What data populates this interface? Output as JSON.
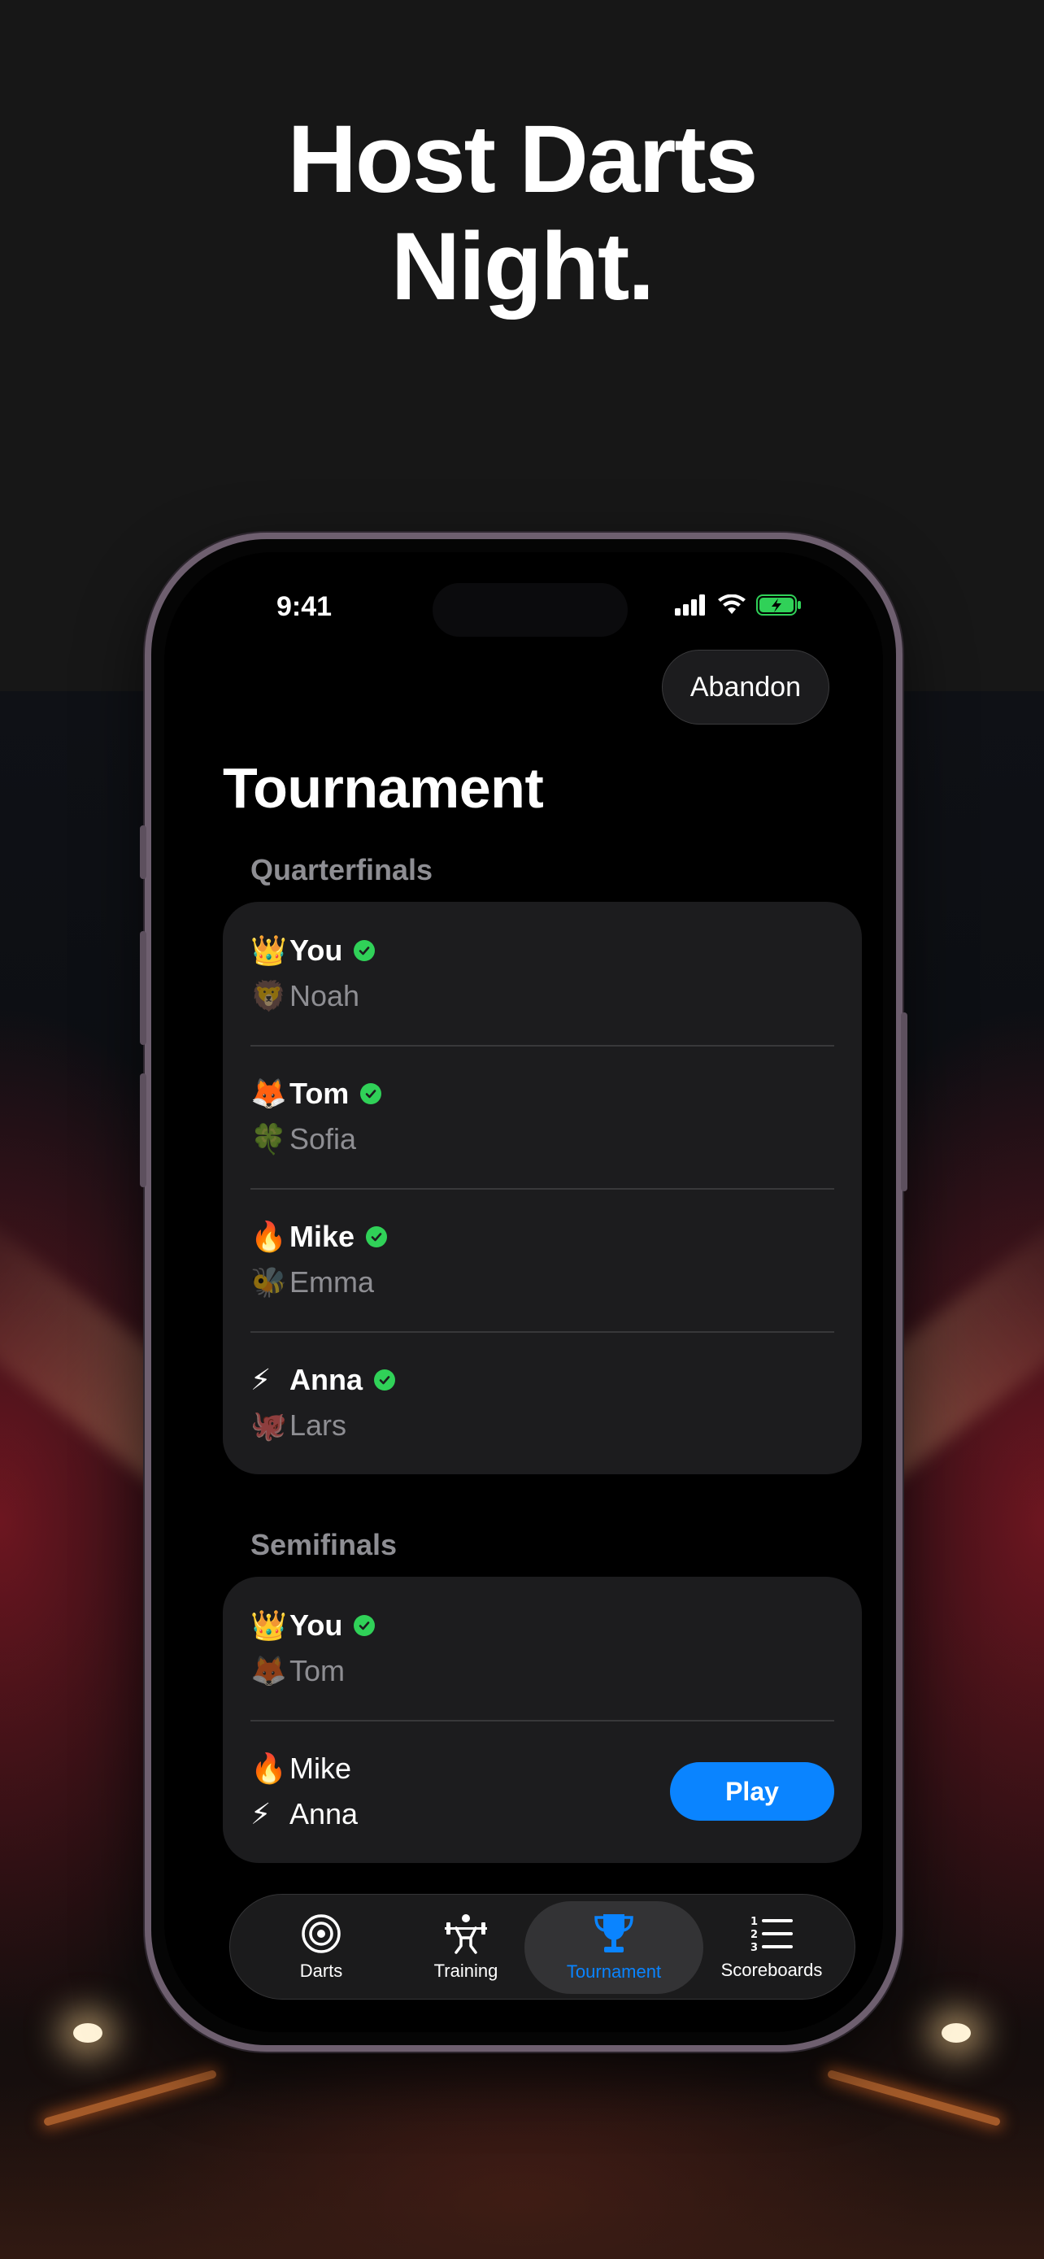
{
  "headline": {
    "line1": "Host Darts",
    "line2": "Night."
  },
  "status_bar": {
    "time": "9:41"
  },
  "header": {
    "abandon_label": "Abandon",
    "title": "Tournament"
  },
  "quarterfinals": {
    "label": "Quarterfinals",
    "matches": [
      {
        "winner": {
          "emoji": "👑",
          "name": "You"
        },
        "loser": {
          "emoji": "🦁",
          "name": "Noah"
        }
      },
      {
        "winner": {
          "emoji": "🦊",
          "name": "Tom"
        },
        "loser": {
          "emoji": "🍀",
          "name": "Sofia"
        }
      },
      {
        "winner": {
          "emoji": "🔥",
          "name": "Mike"
        },
        "loser": {
          "emoji": "🐝",
          "name": "Emma"
        }
      },
      {
        "winner": {
          "emoji": "⚡",
          "name": "Anna"
        },
        "loser": {
          "emoji": "🐙",
          "name": "Lars"
        }
      }
    ]
  },
  "semifinals": {
    "label": "Semifinals",
    "matches": [
      {
        "winner": {
          "emoji": "👑",
          "name": "You"
        },
        "loser": {
          "emoji": "🦊",
          "name": "Tom"
        }
      },
      {
        "player1": {
          "emoji": "🔥",
          "name": "Mike"
        },
        "player2": {
          "emoji": "⚡",
          "name": "Anna"
        },
        "play_label": "Play"
      }
    ]
  },
  "tabbar": {
    "tabs": [
      {
        "label": "Darts",
        "icon": "target-icon"
      },
      {
        "label": "Training",
        "icon": "weightlifter-icon"
      },
      {
        "label": "Tournament",
        "icon": "trophy-icon",
        "active": true
      },
      {
        "label": "Scoreboards",
        "icon": "numbered-list-icon"
      }
    ]
  },
  "colors": {
    "accent": "#0a84ff",
    "check": "#30d158",
    "card": "#1c1c1e",
    "muted": "#8e8e93"
  }
}
